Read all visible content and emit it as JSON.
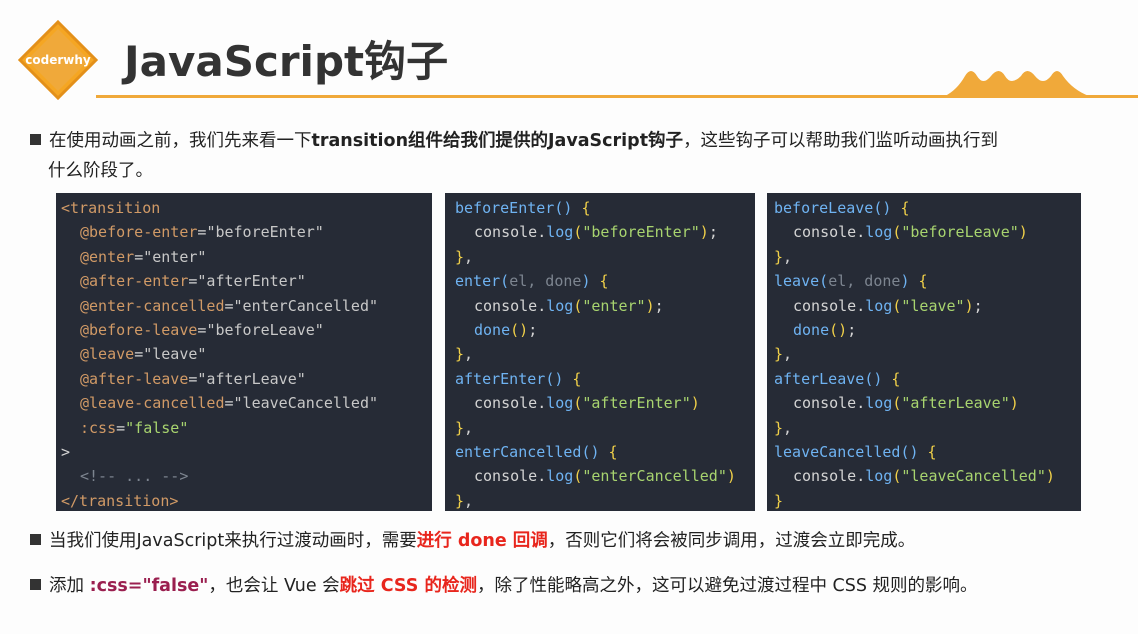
{
  "header": {
    "logo_text": "coderwhy",
    "title": "JavaScript钩子",
    "accent_color": "#f0a93a"
  },
  "bullets": {
    "b1_pre": "在使用动画之前，我们先来看一下",
    "b1_bold": "transition组件给我们提供的JavaScript钩子",
    "b1_post": "，这些钩子可以帮助我们监听动画执行到",
    "b1_line2": "什么阶段了。",
    "b2_pre": "当我们使用JavaScript来执行过渡动画时，需要",
    "b2_red": "进行 done 回调",
    "b2_post": "，否则它们将会被同步调用，过渡会立即完成。",
    "b3_pre": "添加 ",
    "b3_purple": ":css=\"false\"",
    "b3_mid": "，也会让 Vue 会",
    "b3_red": "跳过 CSS 的检测",
    "b3_post": "，除了性能略高之外，这可以避免过渡过程中 CSS 规则的影响。"
  },
  "code": {
    "template": {
      "open": "<transition",
      "attrs": [
        {
          "name": "@before-enter",
          "value": "\"beforeEnter\""
        },
        {
          "name": "@enter",
          "value": "\"enter\""
        },
        {
          "name": "@after-enter",
          "value": "\"afterEnter\""
        },
        {
          "name": "@enter-cancelled",
          "value": "\"enterCancelled\""
        },
        {
          "name": "@before-leave",
          "value": "\"beforeLeave\""
        },
        {
          "name": "@leave",
          "value": "\"leave\""
        },
        {
          "name": "@after-leave",
          "value": "\"afterLeave\""
        },
        {
          "name": "@leave-cancelled",
          "value": "\"leaveCancelled\""
        },
        {
          "name": ":css",
          "value": "\"false\""
        }
      ],
      "close_bracket": ">",
      "comment": "<!-- ... -->",
      "end": "</transition>"
    },
    "enter_hooks": {
      "beforeEnter_sig": "beforeEnter",
      "beforeEnter_str": "\"beforeEnter\"",
      "enter_sig": "enter",
      "enter_params": "el, done",
      "enter_str": "\"enter\"",
      "done_call": "done",
      "afterEnter_sig": "afterEnter",
      "afterEnter_str": "\"afterEnter\"",
      "enterCancelled_sig": "enterCancelled",
      "enterCancelled_str": "\"enterCancelled\""
    },
    "leave_hooks": {
      "beforeLeave_sig": "beforeLeave",
      "beforeLeave_str": "\"beforeLeave\"",
      "leave_sig": "leave",
      "leave_params": "el, done",
      "leave_str": "\"leave\"",
      "done_call": "done",
      "afterLeave_sig": "afterLeave",
      "afterLeave_str": "\"afterLeave\"",
      "leaveCancelled_sig": "leaveCancelled",
      "leaveCancelled_str": "\"leaveCancelled\""
    }
  }
}
